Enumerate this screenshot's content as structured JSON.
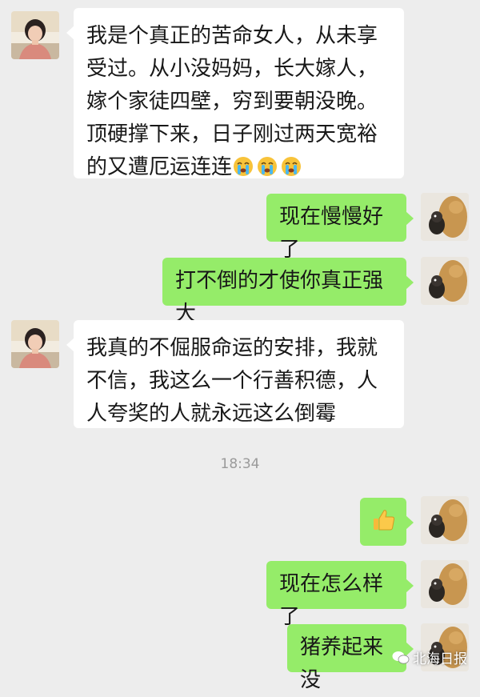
{
  "chat": {
    "messages": [
      {
        "side": "left",
        "text": "我是个真正的苦命女人，从未享受过。从小没妈妈，长大嫁人，嫁个家徒四壁，穷到要朝没晚。顶硬撑下来，日子刚过两天宽裕的又遭厄运连连"
      },
      {
        "side": "right",
        "text": "现在慢慢好了"
      },
      {
        "side": "right",
        "text": "打不倒的才使你真正强大"
      },
      {
        "side": "left",
        "text": "我真的不倔服命运的安排，我就不信，我这么一个行善积德，人人夸奖的人就永远这么倒霉"
      },
      {
        "side": "right",
        "text": ""
      },
      {
        "side": "right",
        "text": "现在怎么样了"
      },
      {
        "side": "right",
        "text": "猪养起来没"
      }
    ],
    "timestamp": "18:34",
    "emoji_names": [
      "crying-face-icon",
      "crying-face-icon",
      "crying-face-icon",
      "thumbs-up-icon"
    ]
  },
  "watermark": {
    "text": "北海日报"
  },
  "colors": {
    "background": "#ededed",
    "incoming_bubble": "#ffffff",
    "outgoing_bubble": "#95ec69",
    "timestamp": "#9a9a9a"
  }
}
